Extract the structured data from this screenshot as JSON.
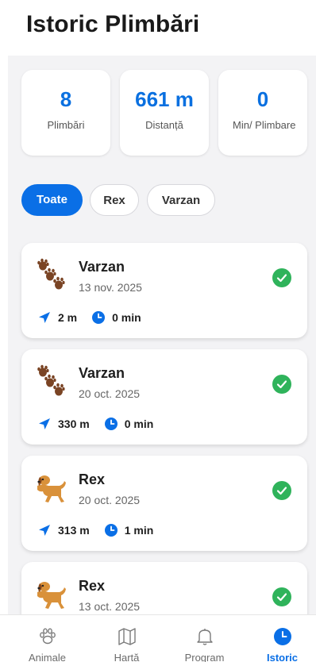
{
  "header": {
    "title": "Istoric Plimbări"
  },
  "stats": [
    {
      "value": "8",
      "label": "Plimbări"
    },
    {
      "value": "661 m",
      "label": "Distanță"
    },
    {
      "value": "0",
      "label": "Min/ Plimbare"
    }
  ],
  "filters": [
    {
      "label": "Toate",
      "active": true
    },
    {
      "label": "Rex",
      "active": false
    },
    {
      "label": "Varzan",
      "active": false
    }
  ],
  "walks": [
    {
      "name": "Varzan",
      "date": "13 nov. 2025",
      "distance": "2 m",
      "duration": "0 min",
      "avatar": "paw-prints-icon",
      "completed": true
    },
    {
      "name": "Varzan",
      "date": "20 oct. 2025",
      "distance": "330 m",
      "duration": "0 min",
      "avatar": "paw-prints-icon",
      "completed": true
    },
    {
      "name": "Rex",
      "date": "20 oct. 2025",
      "distance": "313 m",
      "duration": "1 min",
      "avatar": "dog-icon",
      "completed": true
    },
    {
      "name": "Rex",
      "date": "13 oct. 2025",
      "distance": "",
      "duration": "",
      "avatar": "dog-icon",
      "completed": true
    }
  ],
  "nav": [
    {
      "label": "Animale",
      "icon": "paw-icon",
      "active": false
    },
    {
      "label": "Hartă",
      "icon": "map-icon",
      "active": false
    },
    {
      "label": "Program",
      "icon": "bell-icon",
      "active": false
    },
    {
      "label": "Istoric",
      "icon": "clock-icon",
      "active": true
    }
  ],
  "colors": {
    "accent": "#0a6fe6",
    "check": "#2fb35b",
    "background": "#f3f3f5"
  }
}
